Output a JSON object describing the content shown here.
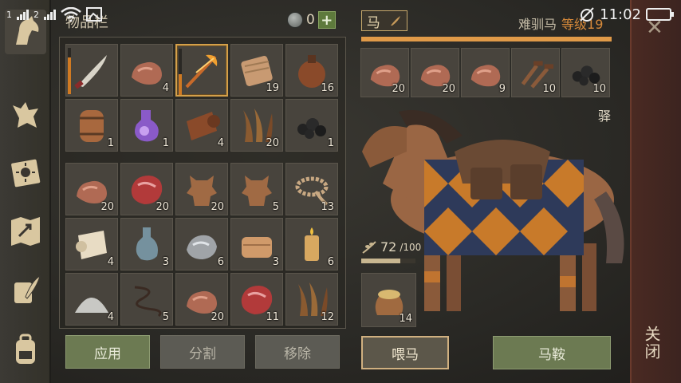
{
  "status_bar": {
    "left_indicators": [
      "1",
      "2"
    ],
    "time": "11:02"
  },
  "sidebar": {
    "items": [
      {
        "name": "horse-head-icon",
        "active": true
      },
      {
        "name": "wolf-icon"
      },
      {
        "name": "journal-icon"
      },
      {
        "name": "map-icon"
      },
      {
        "name": "quill-scroll-icon"
      },
      {
        "name": "backpack-icon"
      }
    ]
  },
  "inventory": {
    "title": "物品栏",
    "currency_value": "0",
    "plus_label": "+",
    "upper_grid": [
      {
        "icon": "saber-icon",
        "qty": "",
        "durability": 0.8
      },
      {
        "icon": "copper-ore-icon",
        "qty": "4"
      },
      {
        "icon": "flaming-arrow-icon",
        "qty": "",
        "durability": 0.45,
        "selected": true
      },
      {
        "icon": "cloth-bolt-icon",
        "qty": "19"
      },
      {
        "icon": "clay-flask-icon",
        "qty": "16"
      },
      {
        "icon": "wooden-barrel-icon",
        "qty": "1"
      },
      {
        "icon": "purple-potion-icon",
        "qty": "1"
      },
      {
        "icon": "leather-roll-icon",
        "qty": "4"
      },
      {
        "icon": "dry-grass-icon",
        "qty": "20"
      },
      {
        "icon": "coal-icon",
        "qty": "1"
      }
    ],
    "lower_grid": [
      {
        "icon": "copper-ore-icon",
        "qty": "20"
      },
      {
        "icon": "raw-meat-icon",
        "qty": "20"
      },
      {
        "icon": "animal-hide-icon",
        "qty": "20"
      },
      {
        "icon": "animal-hide-icon",
        "qty": "5"
      },
      {
        "icon": "rope-icon",
        "qty": "13"
      },
      {
        "icon": "paper-roll-icon",
        "qty": "4"
      },
      {
        "icon": "glass-bottle-icon",
        "qty": "3"
      },
      {
        "icon": "iron-ore-icon",
        "qty": "6"
      },
      {
        "icon": "folded-cloth-icon",
        "qty": "3"
      },
      {
        "icon": "candle-icon",
        "qty": "6"
      },
      {
        "icon": "salt-pile-icon",
        "qty": "4"
      },
      {
        "icon": "cord-icon",
        "qty": "5"
      },
      {
        "icon": "copper-ore-icon",
        "qty": "20"
      },
      {
        "icon": "raw-meat-icon",
        "qty": "11"
      },
      {
        "icon": "dry-grass-icon",
        "qty": "12"
      }
    ],
    "buttons": {
      "apply": "应用",
      "split": "分割",
      "remove": "移除"
    }
  },
  "horse": {
    "tab_label": "马",
    "name": "难驯马",
    "level": "等级19",
    "xp_fraction": 1.0,
    "saddlebag": [
      {
        "icon": "copper-ore-icon",
        "qty": "20"
      },
      {
        "icon": "copper-ore-icon",
        "qty": "20"
      },
      {
        "icon": "copper-ore-icon",
        "qty": "9"
      },
      {
        "icon": "nails-icon",
        "qty": "10"
      },
      {
        "icon": "coal-icon",
        "qty": "10"
      }
    ],
    "tame_label": "驿",
    "food_value": "72",
    "food_max": "/100",
    "food_fraction": 0.72,
    "feed_item": {
      "icon": "grain-sack-icon",
      "qty": "14"
    },
    "buttons": {
      "feed": "喂马",
      "saddle": "马鞍"
    }
  },
  "close": {
    "label": "关闭"
  },
  "colors": {
    "accent_orange": "#e09a48",
    "button_green": "#6c7a52",
    "close_strip": "#4a2a22"
  }
}
